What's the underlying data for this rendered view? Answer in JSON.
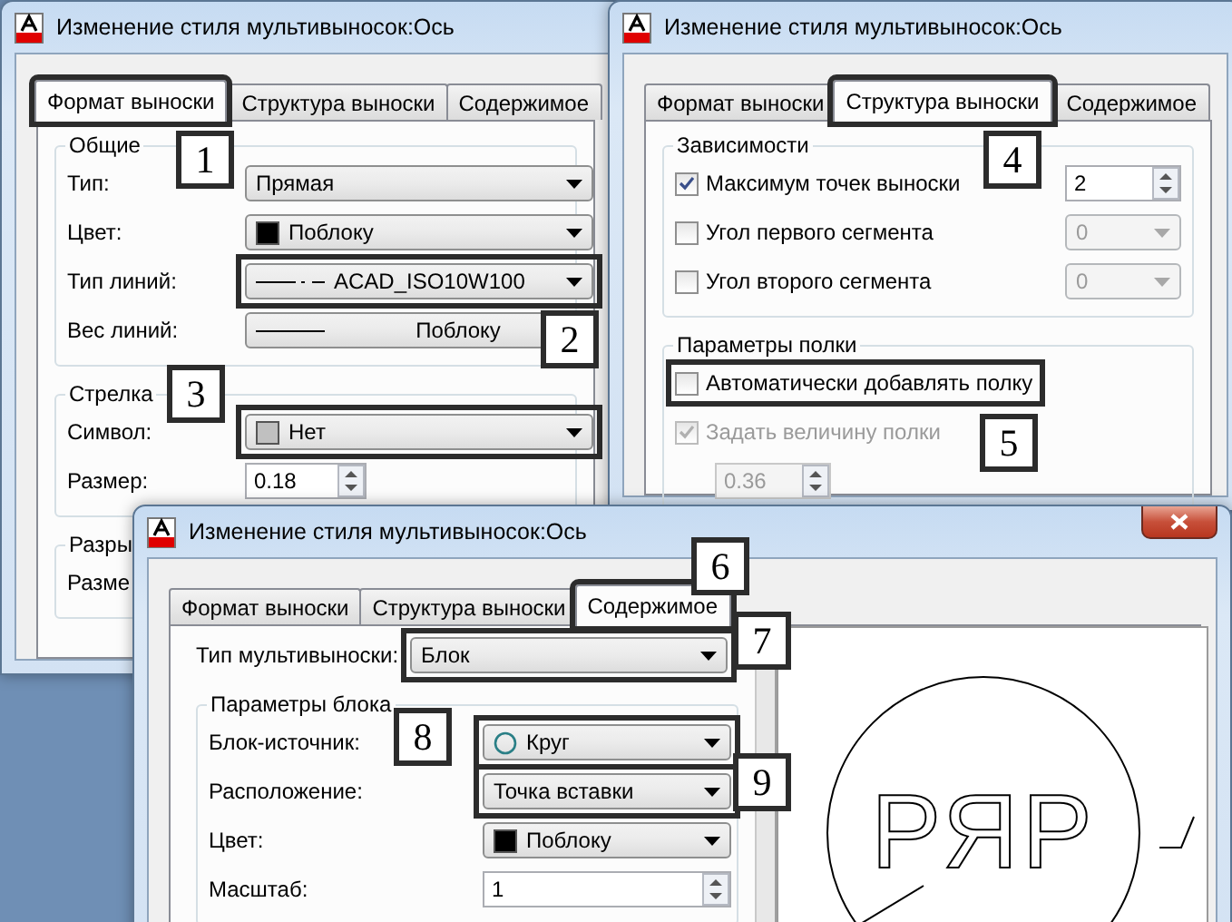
{
  "windows": [
    {
      "title": "Изменение стиля мультивыносок:Ось",
      "close_button": false,
      "tabs": [
        {
          "label": "Формат выноски",
          "selected": true,
          "highlighted": true
        },
        {
          "label": "Структура выноски",
          "selected": false,
          "highlighted": false
        },
        {
          "label": "Содержимое",
          "selected": false,
          "highlighted": false
        }
      ],
      "groups": [
        {
          "title": "Общие",
          "rows": [
            {
              "kind": "combo",
              "label": "Тип:",
              "value": "Прямая",
              "disabled": false,
              "highlighted": false
            },
            {
              "kind": "color-combo",
              "label": "Цвет:",
              "value": "Поблоку",
              "disabled": false,
              "highlighted": false
            },
            {
              "kind": "linetype-combo",
              "label": "Тип линий:",
              "value": "ACAD_ISO10W100",
              "disabled": false,
              "highlighted": true
            },
            {
              "kind": "lineweight-button",
              "label": "Вес линий:",
              "value": "Поблоку"
            }
          ]
        },
        {
          "title": "Стрелка",
          "rows": [
            {
              "kind": "symbol-combo",
              "label": "Символ:",
              "value": "Нет",
              "disabled": false,
              "highlighted": true
            },
            {
              "kind": "spinner",
              "label": "Размер:",
              "value": "0.18",
              "disabled": false
            }
          ]
        },
        {
          "title": "Разры",
          "rows": [
            {
              "kind": "text",
              "label": "Разме"
            }
          ]
        }
      ]
    },
    {
      "title": "Изменение стиля мультивыносок:Ось",
      "close_button": false,
      "tabs": [
        {
          "label": "Формат выноски",
          "selected": false,
          "highlighted": false
        },
        {
          "label": "Структура выноски",
          "selected": true,
          "highlighted": true
        },
        {
          "label": "Содержимое",
          "selected": false,
          "highlighted": false
        }
      ],
      "groups": [
        {
          "title": "Зависимости",
          "rows": [
            {
              "kind": "check",
              "label": "Максимум точек выноски",
              "checked": true,
              "disabled": false,
              "highlighted": false,
              "control": {
                "kind": "spinner",
                "value": "2",
                "disabled": false
              }
            },
            {
              "kind": "check",
              "label": "Угол первого сегмента",
              "checked": false,
              "disabled": false,
              "highlighted": false,
              "control": {
                "kind": "combo",
                "value": "0",
                "disabled": true,
                "highlighted": false
              }
            },
            {
              "kind": "check",
              "label": "Угол второго сегмента",
              "checked": false,
              "disabled": false,
              "highlighted": false,
              "control": {
                "kind": "combo",
                "value": "0",
                "disabled": true,
                "highlighted": false
              }
            }
          ]
        },
        {
          "title": "Параметры полки",
          "rows": [
            {
              "kind": "check",
              "label": "Автоматически добавлять полку",
              "checked": false,
              "disabled": false,
              "highlighted": true
            },
            {
              "kind": "check",
              "label": "Задать величину полки",
              "checked": true,
              "disabled": true,
              "highlighted": false
            },
            {
              "kind": "spinner",
              "value": "0.36",
              "disabled": true
            }
          ]
        }
      ]
    },
    {
      "title": "Изменение стиля мультивыносок:Ось",
      "close_button": true,
      "tabs": [
        {
          "label": "Формат выноски",
          "selected": false,
          "highlighted": false
        },
        {
          "label": "Структура выноски",
          "selected": false,
          "highlighted": false
        },
        {
          "label": "Содержимое",
          "selected": true,
          "highlighted": true
        }
      ],
      "top_rows": [
        {
          "kind": "combo",
          "label": "Тип мультивыноски:",
          "value": "Блок",
          "disabled": false,
          "highlighted": true
        }
      ],
      "groups": [
        {
          "title": "Параметры блока",
          "rows": [
            {
              "kind": "block-combo",
              "label": "Блок-источник:",
              "value": "Круг",
              "disabled": false,
              "highlighted": true
            },
            {
              "kind": "combo",
              "label": "Расположение:",
              "value": "Точка вставки",
              "disabled": false,
              "highlighted": true
            },
            {
              "kind": "color-combo",
              "label": "Цвет:",
              "value": "Поблоку",
              "disabled": false,
              "highlighted": false
            },
            {
              "kind": "spinner",
              "label": "Масштаб:",
              "value": "1",
              "disabled": false
            }
          ]
        }
      ],
      "preview": {
        "text": "РЯР"
      }
    }
  ],
  "callouts": [
    {
      "label": "1"
    },
    {
      "label": "2"
    },
    {
      "label": "3"
    },
    {
      "label": "4"
    },
    {
      "label": "5"
    },
    {
      "label": "6"
    },
    {
      "label": "7"
    },
    {
      "label": "8"
    },
    {
      "label": "9"
    }
  ]
}
